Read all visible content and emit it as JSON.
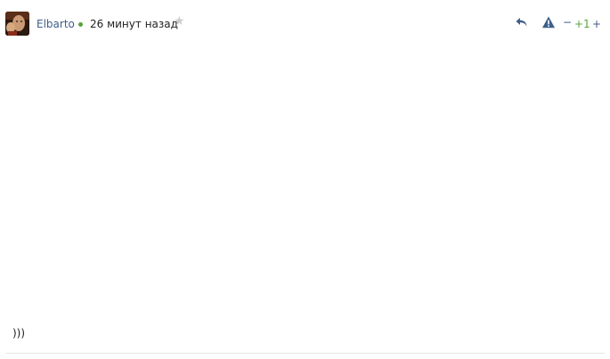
{
  "comment": {
    "author": "Elbarto",
    "time": "26 минут назад",
    "body": ")))",
    "rating": {
      "minus_label": "−",
      "score": "+1",
      "plus_label": "+"
    }
  },
  "icons": {
    "avatar": "user-avatar",
    "online": "online-dot",
    "favorite": "star-icon",
    "reply": "reply-icon",
    "report": "warning-icon"
  },
  "colors": {
    "link": "#3d5f8a",
    "positive": "#56a33c",
    "star_inactive": "#cccccc"
  }
}
